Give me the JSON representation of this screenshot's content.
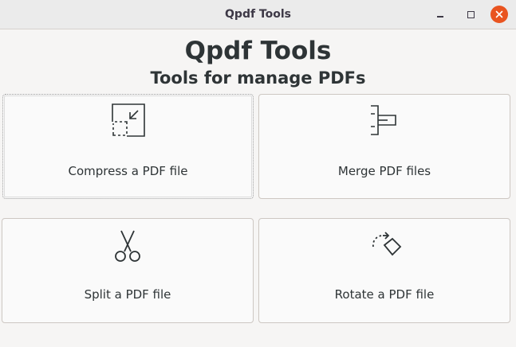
{
  "window": {
    "title": "Qpdf Tools",
    "close_color": "#e95420"
  },
  "header": {
    "title": "Qpdf Tools",
    "subtitle": "Tools for manage PDFs"
  },
  "tools": {
    "compress": {
      "label": "Compress a PDF file",
      "icon": "compress-icon"
    },
    "merge": {
      "label": "Merge PDF files",
      "icon": "merge-icon"
    },
    "split": {
      "label": "Split a PDF file",
      "icon": "scissors-icon"
    },
    "rotate": {
      "label": "Rotate a PDF file",
      "icon": "rotate-icon"
    }
  }
}
